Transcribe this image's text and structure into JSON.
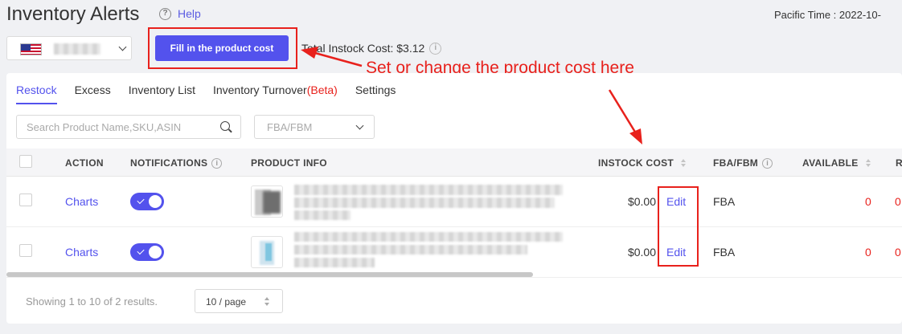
{
  "header": {
    "title": "Inventory Alerts",
    "help_label": "Help",
    "pacific_time": "Pacific Time : 2022-10-"
  },
  "toolbar": {
    "fill_cost_label": "Fill in the product cost",
    "total_instock_cost": "Total Instock Cost: $3.12"
  },
  "annotation": {
    "text": "Set or change the product cost here",
    "color": "#e8211c"
  },
  "tabs": [
    {
      "label": "Restock",
      "active": true
    },
    {
      "label": "Excess"
    },
    {
      "label": "Inventory List"
    },
    {
      "label": "Inventory Turnover",
      "suffix": "(Beta)"
    },
    {
      "label": "Settings"
    }
  ],
  "filters": {
    "search_placeholder": "Search Product Name,SKU,ASIN",
    "fulfillment_placeholder": "FBA/FBM"
  },
  "table": {
    "columns": {
      "action": "ACTION",
      "notifications": "NOTIFICATIONS",
      "product_info": "PRODUCT INFO",
      "instock_cost": "INSTOCK COST",
      "fba_fbm": "FBA/FBM",
      "available": "AVAILABLE",
      "next": "R"
    },
    "rows": [
      {
        "action": "Charts",
        "notifications_on": true,
        "cost": "$0.00",
        "edit": "Edit",
        "fulfillment": "FBA",
        "available": "0",
        "next": "0"
      },
      {
        "action": "Charts",
        "notifications_on": true,
        "cost": "$0.00",
        "edit": "Edit",
        "fulfillment": "FBA",
        "available": "0",
        "next": "0"
      }
    ]
  },
  "footer": {
    "showing": "Showing 1 to 10 of 2 results.",
    "page_size": "10 / page"
  },
  "colors": {
    "accent": "#5352ed",
    "alert": "#e8211c"
  }
}
